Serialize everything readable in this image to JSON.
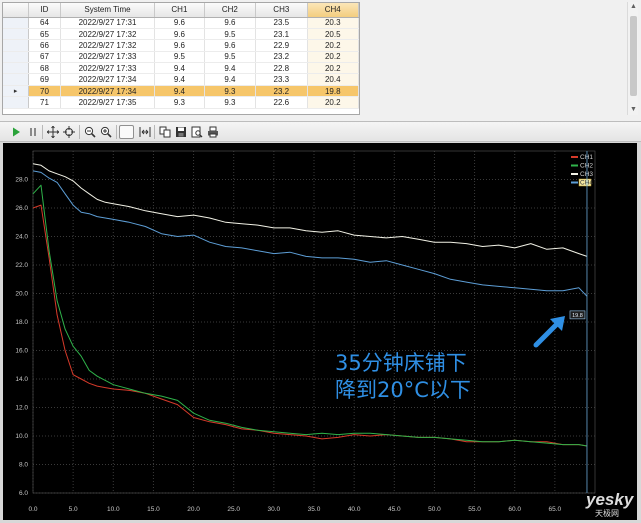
{
  "table": {
    "columns": [
      "ID",
      "System Time",
      "CH1",
      "CH2",
      "CH3",
      "CH4"
    ],
    "rows": [
      [
        "64",
        "2022/9/27 17:31",
        "9.6",
        "9.6",
        "23.5",
        "20.3"
      ],
      [
        "65",
        "2022/9/27 17:32",
        "9.6",
        "9.5",
        "23.1",
        "20.5"
      ],
      [
        "66",
        "2022/9/27 17:32",
        "9.6",
        "9.6",
        "22.9",
        "20.2"
      ],
      [
        "67",
        "2022/9/27 17:33",
        "9.5",
        "9.5",
        "23.2",
        "20.2"
      ],
      [
        "68",
        "2022/9/27 17:33",
        "9.4",
        "9.4",
        "22.8",
        "20.2"
      ],
      [
        "69",
        "2022/9/27 17:34",
        "9.4",
        "9.4",
        "23.3",
        "20.4"
      ],
      [
        "70",
        "2022/9/27 17:34",
        "9.4",
        "9.3",
        "23.2",
        "19.8"
      ],
      [
        "71",
        "2022/9/27 17:35",
        "9.3",
        "9.3",
        "22.6",
        "20.2"
      ]
    ],
    "selected_row_index": 6,
    "selected_row_marker": "▸"
  },
  "toolbar": {
    "buttons": [
      {
        "name": "play-icon"
      },
      {
        "name": "pause-icon"
      },
      {
        "name": "crosshair-icon"
      },
      {
        "name": "target-icon"
      },
      {
        "name": "zoom-out-icon"
      },
      {
        "name": "zoom-in-icon"
      },
      {
        "name": "box-icon"
      },
      {
        "name": "fit-width-icon"
      },
      {
        "name": "copy-icon"
      },
      {
        "name": "save-icon"
      },
      {
        "name": "print-preview-icon"
      },
      {
        "name": "print-icon"
      }
    ]
  },
  "annotation": {
    "line1": "35分钟床铺下",
    "line2": "降到20°C以下",
    "cursor_label": "19.8"
  },
  "watermark": {
    "brand": "yesky",
    "sub": "天极网"
  },
  "chart_data": {
    "type": "line",
    "xlim": [
      0,
      70
    ],
    "ylim": [
      6.0,
      30.0
    ],
    "x_ticks": [
      "0.0",
      "5.0",
      "10.0",
      "15.0",
      "20.0",
      "25.0",
      "30.0",
      "35.0",
      "40.0",
      "45.0",
      "50.0",
      "55.0",
      "60.0",
      "65.0"
    ],
    "y_ticks": [
      "6.0",
      "8.0",
      "10.0",
      "12.0",
      "14.0",
      "16.0",
      "18.0",
      "20.0",
      "22.0",
      "24.0",
      "26.0",
      "28.0"
    ],
    "grid": true,
    "legend_position": "top-right",
    "cursor_x": 69,
    "series": [
      {
        "name": "CH1",
        "color": "#d63a2a",
        "x": [
          0,
          1,
          2,
          3,
          4,
          5,
          6,
          7,
          8,
          9,
          10,
          12,
          14,
          16,
          18,
          20,
          22,
          24,
          26,
          28,
          30,
          32,
          34,
          36,
          38,
          40,
          42,
          44,
          46,
          48,
          50,
          52,
          54,
          56,
          58,
          60,
          62,
          64,
          66,
          68,
          69
        ],
        "y": [
          26.0,
          26.2,
          22.5,
          18.5,
          16.0,
          14.3,
          14.0,
          13.7,
          13.5,
          13.4,
          13.3,
          13.2,
          13.0,
          12.6,
          12.2,
          11.3,
          11.0,
          10.8,
          10.5,
          10.4,
          10.2,
          10.1,
          10.0,
          9.8,
          9.9,
          10.1,
          10.0,
          10.1,
          10.0,
          9.9,
          9.9,
          9.8,
          9.6,
          9.6,
          9.6,
          9.7,
          9.6,
          9.6,
          9.4,
          9.4,
          9.3
        ]
      },
      {
        "name": "CH2",
        "color": "#2fb34a",
        "x": [
          0,
          1,
          2,
          3,
          4,
          5,
          6,
          7,
          8,
          9,
          10,
          12,
          14,
          16,
          18,
          20,
          22,
          24,
          26,
          28,
          30,
          32,
          34,
          36,
          38,
          40,
          42,
          44,
          46,
          48,
          50,
          52,
          54,
          56,
          58,
          60,
          62,
          64,
          66,
          68,
          69
        ],
        "y": [
          27.0,
          27.6,
          23.0,
          19.5,
          17.5,
          16.3,
          15.6,
          14.6,
          14.2,
          13.9,
          13.6,
          13.3,
          13.0,
          12.8,
          12.5,
          11.6,
          11.1,
          10.9,
          10.6,
          10.4,
          10.3,
          10.2,
          10.1,
          10.2,
          10.1,
          10.2,
          10.2,
          10.1,
          10.0,
          9.9,
          9.9,
          9.8,
          9.7,
          9.6,
          9.6,
          9.7,
          9.6,
          9.5,
          9.4,
          9.4,
          9.3
        ]
      },
      {
        "name": "CH3",
        "color": "#f2f2e6",
        "x": [
          0,
          1,
          2,
          3,
          4,
          5,
          6,
          7,
          8,
          9,
          10,
          12,
          14,
          16,
          18,
          20,
          22,
          24,
          26,
          28,
          30,
          32,
          34,
          36,
          38,
          40,
          42,
          44,
          46,
          48,
          50,
          52,
          54,
          56,
          58,
          60,
          62,
          64,
          66,
          68,
          69
        ],
        "y": [
          29.1,
          29.0,
          28.6,
          28.4,
          28.2,
          27.9,
          27.4,
          27.0,
          26.6,
          26.4,
          26.3,
          26.1,
          25.8,
          25.6,
          25.4,
          25.5,
          25.3,
          25.0,
          24.9,
          24.8,
          24.6,
          24.6,
          24.4,
          24.3,
          24.4,
          24.1,
          24.0,
          23.9,
          24.0,
          23.8,
          23.6,
          23.6,
          23.5,
          23.3,
          23.4,
          23.2,
          23.5,
          23.1,
          23.2,
          22.8,
          22.6
        ]
      },
      {
        "name": "CH4",
        "color": "#5d9ed6",
        "x": [
          0,
          1,
          2,
          3,
          4,
          5,
          6,
          7,
          8,
          9,
          10,
          12,
          14,
          16,
          18,
          20,
          22,
          24,
          26,
          28,
          30,
          32,
          34,
          36,
          38,
          40,
          42,
          44,
          46,
          48,
          50,
          52,
          54,
          56,
          58,
          60,
          62,
          64,
          66,
          68,
          69
        ],
        "y": [
          28.6,
          28.5,
          28.1,
          27.8,
          27.0,
          26.2,
          25.7,
          25.6,
          25.4,
          25.3,
          25.2,
          25.0,
          24.7,
          24.2,
          24.0,
          24.1,
          23.6,
          23.3,
          23.2,
          23.0,
          22.8,
          22.9,
          22.6,
          22.5,
          22.5,
          22.4,
          22.2,
          22.3,
          22.0,
          21.7,
          21.4,
          21.0,
          20.8,
          20.6,
          20.5,
          20.4,
          20.3,
          20.2,
          20.2,
          20.4,
          19.8
        ]
      }
    ]
  }
}
